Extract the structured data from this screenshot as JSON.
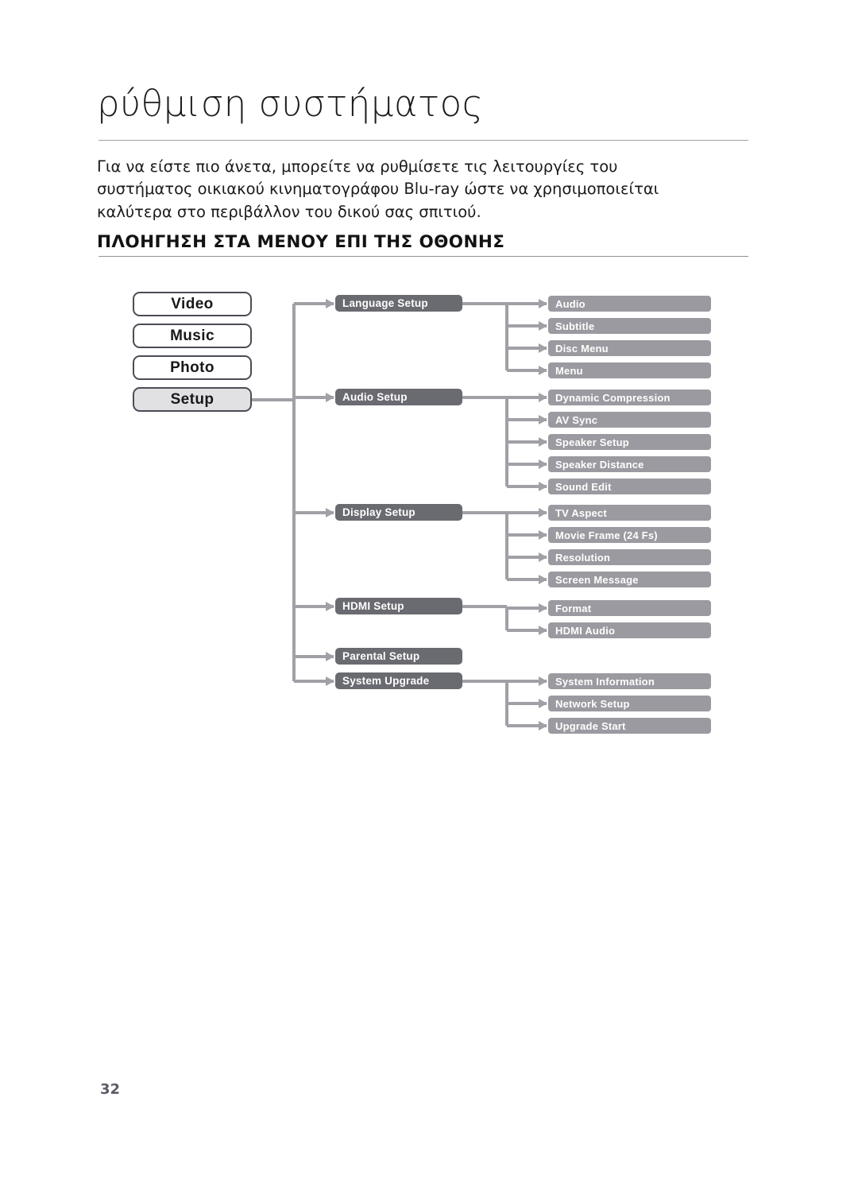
{
  "page": {
    "title": "ρύθμιση συστήματος",
    "intro": "Για να είστε πιο άνετα, μπορείτε να ρυθμίσετε τις λειτουργίες του συστήματος οικιακού κινηματογράφου Blu-ray ώστε να χρησιμοποιείται καλύτερα στο περιβάλλον του δικού σας σπιτιού.",
    "section_heading": "ΠΛΟΗΓΗΣΗ ΣΤΑ ΜΕΝΟΥ ΕΠΙ ΤΗΣ ΟΘΟΝΗΣ",
    "page_number": "32"
  },
  "colors": {
    "source_border": "#4c4c57",
    "source_selected_fill": "#e1e1e3",
    "group_fill": "#6a6a71",
    "leaf_fill": "#9a9aa0",
    "connector": "#a0a0a6",
    "rule": "#8d9499"
  },
  "menu_tree": {
    "sources": [
      {
        "label": "Video",
        "selected": false
      },
      {
        "label": "Music",
        "selected": false
      },
      {
        "label": "Photo",
        "selected": false
      },
      {
        "label": "Setup",
        "selected": true
      }
    ],
    "groups": [
      {
        "label": "Language Setup",
        "items": [
          "Audio",
          "Subtitle",
          "Disc Menu",
          "Menu"
        ]
      },
      {
        "label": "Audio Setup",
        "items": [
          "Dynamic Compression",
          "AV Sync",
          "Speaker Setup",
          "Speaker Distance",
          "Sound Edit"
        ]
      },
      {
        "label": "Display Setup",
        "items": [
          "TV Aspect",
          "Movie Frame (24 Fs)",
          "Resolution",
          "Screen Message"
        ]
      },
      {
        "label": "HDMI Setup",
        "items": [
          "Format",
          "HDMI Audio"
        ]
      },
      {
        "label": "Parental Setup",
        "items": []
      },
      {
        "label": "System Upgrade",
        "items": [
          "System Information",
          "Network Setup",
          "Upgrade Start"
        ]
      }
    ]
  }
}
